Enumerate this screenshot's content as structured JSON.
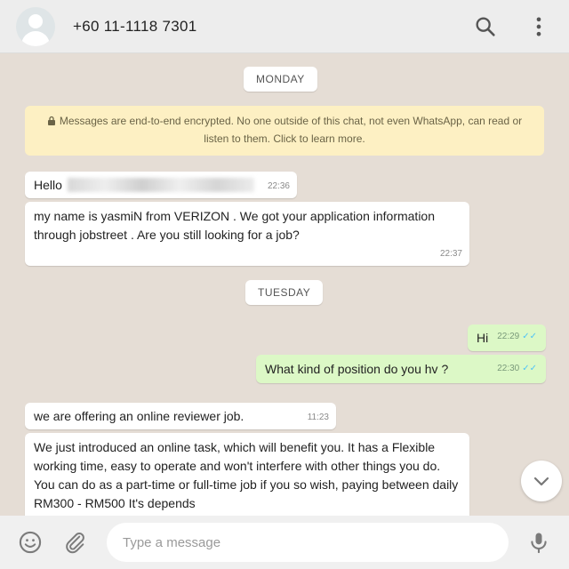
{
  "header": {
    "contact_name": "+60 11-1118 7301",
    "avatar_icon": "default-user-avatar-icon",
    "search_icon": "search-icon",
    "menu_icon": "more-vertical-icon"
  },
  "chat": {
    "day_separators": [
      "MONDAY",
      "TUESDAY"
    ],
    "encryption_notice": "Messages are end-to-end encrypted. No one outside of this chat, not even WhatsApp, can read or listen to them. Click to learn more.",
    "messages": [
      {
        "direction": "incoming",
        "text": "Hello",
        "time": "22:36",
        "redacted": true
      },
      {
        "direction": "incoming",
        "text": "my name is yasmiN from VERIZON . We got your application information through jobstreet . Are you still looking for a job?",
        "time": "22:37"
      },
      {
        "direction": "outgoing",
        "text": "Hi",
        "time": "22:29",
        "status": "read"
      },
      {
        "direction": "outgoing",
        "text": "What kind of position do you hv ?",
        "time": "22:30",
        "status": "read"
      },
      {
        "direction": "incoming",
        "text": "we are offering an online reviewer job.",
        "time": "11:23"
      },
      {
        "direction": "incoming",
        "text": "We just introduced an online task, which will benefit you. It has a Flexible working time, easy to operate and won't interfere with other things you do. You can do as a part-time or full-time job if you so wish, paying between daily  RM300 - RM500 It's depends"
      }
    ],
    "read_ticks": "✓✓",
    "scroll_icon": "chevron-down-icon"
  },
  "composer": {
    "placeholder": "Type a message",
    "value": "",
    "emoji_icon": "emoji-icon",
    "attach_icon": "paperclip-icon",
    "mic_icon": "microphone-icon"
  },
  "colors": {
    "chat_background": "#e5ddd5",
    "incoming_bubble": "#ffffff",
    "outgoing_bubble": "#dcf8c6",
    "notice_background": "#fdf0c3",
    "read_tick": "#4fc3f7"
  }
}
